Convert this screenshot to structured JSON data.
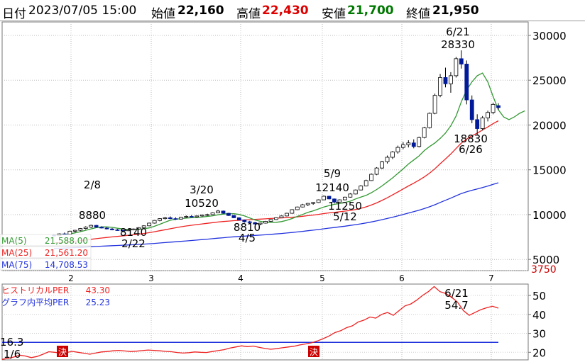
{
  "header": {
    "date_label": "日付",
    "datetime": "2023/07/05 15:00",
    "open_label": "始値",
    "open": "22,160",
    "high_label": "高値",
    "high": "22,430",
    "low_label": "安値",
    "low": "21,700",
    "close_label": "終値",
    "close": "21,950"
  },
  "colors": {
    "high": "#dd0000",
    "low": "#007700",
    "ma5": "#339933",
    "ma25": "#ee2222",
    "ma75": "#2233dd",
    "bull": "#ffffff",
    "bear": "#001a99",
    "per": "#ee2222",
    "avg_per": "#2233dd",
    "badge": "#cc0000"
  },
  "legend": [
    {
      "label": "MA(5)",
      "value": "21,588.00"
    },
    {
      "label": "MA(25)",
      "value": "21,561.20"
    },
    {
      "label": "MA(75)",
      "value": "14,708.53"
    }
  ],
  "per_legend": [
    {
      "label": "ヒストリカルPER",
      "value": "43.30"
    },
    {
      "label": "グラフ内平均PER",
      "value": "25.23"
    }
  ],
  "badge_label": "決",
  "chart_data": [
    {
      "type": "candlestick",
      "x_tick_labels": [
        "2",
        "3",
        "4",
        "5",
        "6",
        "7"
      ],
      "y_ticks": [
        5000,
        10000,
        15000,
        20000,
        25000,
        30000
      ],
      "ylim": [
        3750,
        31500
      ],
      "y_min_label": "3750",
      "annotations": [
        {
          "date": "2/8",
          "value": "8880"
        },
        {
          "date": "2/22",
          "value": "8140"
        },
        {
          "date": "3/20",
          "value": "10520"
        },
        {
          "date": "4/5",
          "value": "8810"
        },
        {
          "date": "5/9",
          "value": "12140"
        },
        {
          "date": "5/12",
          "value": "11250"
        },
        {
          "date": "6/21",
          "value": "28330"
        },
        {
          "date": "6/26",
          "value": "18830"
        }
      ],
      "candles": [
        [
          7700,
          7800,
          7550,
          7650
        ],
        [
          7650,
          7900,
          7600,
          7850
        ],
        [
          7850,
          8000,
          7750,
          7800
        ],
        [
          7800,
          8200,
          7750,
          8150
        ],
        [
          8150,
          8300,
          8000,
          8250
        ],
        [
          8250,
          8500,
          8150,
          8450
        ],
        [
          8450,
          8700,
          8350,
          8600
        ],
        [
          8600,
          8880,
          8500,
          8800
        ],
        [
          8800,
          8850,
          8550,
          8600
        ],
        [
          8600,
          8700,
          8450,
          8500
        ],
        [
          8500,
          8600,
          8350,
          8400
        ],
        [
          8400,
          8500,
          8250,
          8300
        ],
        [
          8300,
          8400,
          8200,
          8250
        ],
        [
          8250,
          8300,
          8140,
          8200
        ],
        [
          8200,
          8350,
          8150,
          8300
        ],
        [
          8300,
          8450,
          8250,
          8400
        ],
        [
          8400,
          8600,
          8350,
          8550
        ],
        [
          8550,
          8800,
          8500,
          8750
        ],
        [
          8750,
          9100,
          8700,
          9050
        ],
        [
          9050,
          9400,
          9000,
          9350
        ],
        [
          9350,
          9600,
          9250,
          9550
        ],
        [
          9550,
          9750,
          9450,
          9650
        ],
        [
          9650,
          9800,
          9500,
          9550
        ],
        [
          9550,
          9700,
          9400,
          9500
        ],
        [
          9500,
          9750,
          9450,
          9700
        ],
        [
          9700,
          9900,
          9600,
          9800
        ],
        [
          9800,
          9950,
          9700,
          9750
        ],
        [
          9750,
          9900,
          9650,
          9850
        ],
        [
          9850,
          10000,
          9750,
          9950
        ],
        [
          9950,
          10100,
          9850,
          10000
        ],
        [
          10000,
          10250,
          9950,
          10200
        ],
        [
          10200,
          10520,
          10150,
          10400
        ],
        [
          10400,
          10450,
          10100,
          10150
        ],
        [
          10150,
          10200,
          9850,
          9900
        ],
        [
          9900,
          9950,
          9600,
          9650
        ],
        [
          9650,
          9700,
          9350,
          9400
        ],
        [
          9400,
          9450,
          9100,
          9200
        ],
        [
          9200,
          9300,
          9000,
          9100
        ],
        [
          9100,
          9200,
          8900,
          8950
        ],
        [
          8950,
          9100,
          8810,
          9050
        ],
        [
          9050,
          9300,
          9000,
          9250
        ],
        [
          9250,
          9500,
          9200,
          9450
        ],
        [
          9450,
          9700,
          9400,
          9650
        ],
        [
          9650,
          9900,
          9600,
          9850
        ],
        [
          9850,
          10200,
          9800,
          10150
        ],
        [
          10150,
          10600,
          10100,
          10550
        ],
        [
          10550,
          10900,
          10500,
          10850
        ],
        [
          10850,
          11200,
          10800,
          11100
        ],
        [
          11100,
          11300,
          10950,
          11250
        ],
        [
          11250,
          11400,
          11100,
          11350
        ],
        [
          11350,
          11700,
          11300,
          11650
        ],
        [
          11650,
          12140,
          11600,
          12050
        ],
        [
          12050,
          12100,
          11700,
          11750
        ],
        [
          11750,
          11800,
          11250,
          11400
        ],
        [
          11400,
          11700,
          11350,
          11650
        ],
        [
          11650,
          12000,
          11600,
          11950
        ],
        [
          11950,
          12400,
          11900,
          12300
        ],
        [
          12300,
          12800,
          12250,
          12750
        ],
        [
          12750,
          13300,
          12700,
          13200
        ],
        [
          13200,
          13900,
          13150,
          13800
        ],
        [
          13800,
          14600,
          13750,
          14500
        ],
        [
          14500,
          15300,
          14400,
          15200
        ],
        [
          15200,
          16000,
          15100,
          15900
        ],
        [
          15900,
          16600,
          15700,
          16400
        ],
        [
          16400,
          17100,
          16200,
          17000
        ],
        [
          17000,
          17700,
          16800,
          17500
        ],
        [
          17500,
          18100,
          17300,
          17800
        ],
        [
          17800,
          18300,
          17500,
          18000
        ],
        [
          18000,
          18400,
          17400,
          17600
        ],
        [
          17600,
          18700,
          17500,
          18600
        ],
        [
          18600,
          19800,
          18500,
          19700
        ],
        [
          19700,
          21400,
          19600,
          21300
        ],
        [
          21300,
          23500,
          21200,
          23300
        ],
        [
          23300,
          25700,
          23100,
          25300
        ],
        [
          25300,
          26400,
          24200,
          24600
        ],
        [
          24600,
          25900,
          23600,
          25500
        ],
        [
          25500,
          27600,
          25300,
          27400
        ],
        [
          27400,
          28330,
          26300,
          26800
        ],
        [
          26800,
          27200,
          22300,
          22800
        ],
        [
          22800,
          23300,
          20200,
          20600
        ],
        [
          20600,
          21200,
          18830,
          19600
        ],
        [
          19600,
          21000,
          19400,
          20800
        ],
        [
          20800,
          21600,
          20400,
          21400
        ],
        [
          21400,
          22500,
          21200,
          22300
        ],
        [
          22160,
          22430,
          21700,
          21950
        ]
      ],
      "ma_series": {
        "MA5": [
          7700,
          7750,
          7780,
          7850,
          7960,
          8100,
          8250,
          8410,
          8540,
          8630,
          8630,
          8580,
          8480,
          8410,
          8330,
          8340,
          8360,
          8420,
          8520,
          8700,
          8920,
          9160,
          9380,
          9480,
          9550,
          9610,
          9650,
          9680,
          9730,
          9800,
          9870,
          9980,
          10060,
          10100,
          10100,
          10020,
          9850,
          9630,
          9400,
          9250,
          9140,
          9120,
          9140,
          9220,
          9360,
          9560,
          9800,
          10020,
          10250,
          10420,
          10630,
          10850,
          11000,
          11150,
          11240,
          11360,
          11500,
          11750,
          11950,
          12150,
          12450,
          12800,
          13200,
          13650,
          14100,
          14600,
          15100,
          15650,
          16100,
          16550,
          17150,
          17600,
          18000,
          18500,
          19100,
          19900,
          21000,
          22600,
          23900,
          24800,
          25500,
          25800,
          24800,
          23200,
          21700,
          20900,
          20600,
          20900,
          21300,
          21588
        ]
      }
    },
    {
      "type": "line",
      "y_ticks": [
        20,
        30,
        40,
        50
      ],
      "ylim": [
        16,
        56
      ],
      "start_label": "1/6",
      "start_value": "16.3",
      "annotation": {
        "date": "6/21",
        "value": "54.7"
      },
      "series": [
        {
          "name": "ヒストリカルPER",
          "values": [
            16.3,
            16.8,
            17.5,
            18.5,
            18.0,
            17.2,
            17.8,
            19.0,
            20.3,
            20.0,
            19.6,
            19.9,
            20.5,
            20.0,
            19.5,
            19.0,
            19.6,
            20.2,
            20.4,
            20.8,
            21.0,
            20.7,
            20.4,
            20.6,
            20.9,
            21.2,
            21.0,
            20.8,
            20.5,
            20.3,
            19.9,
            19.6,
            19.8,
            20.2,
            20.0,
            19.9,
            20.4,
            20.9,
            21.4,
            22.2,
            22.8,
            23.4,
            23.0,
            23.3,
            22.6,
            22.0,
            21.6,
            21.9,
            22.4,
            22.8,
            23.2,
            23.9,
            24.4,
            25.0,
            26.0,
            27.2,
            28.6,
            30.4,
            31.4,
            33.0,
            34.0,
            36.0,
            37.0,
            38.6,
            38.0,
            40.0,
            41.0,
            39.5,
            42.0,
            44.5,
            45.5,
            47.5,
            50.0,
            52.0,
            54.7,
            52.0,
            51.0,
            49.0,
            46.5,
            42.0,
            39.5,
            41.0,
            42.5,
            43.5,
            44.3,
            43.3
          ]
        },
        {
          "name": "グラフ内平均PER",
          "values": [
            25.23
          ]
        }
      ]
    }
  ]
}
